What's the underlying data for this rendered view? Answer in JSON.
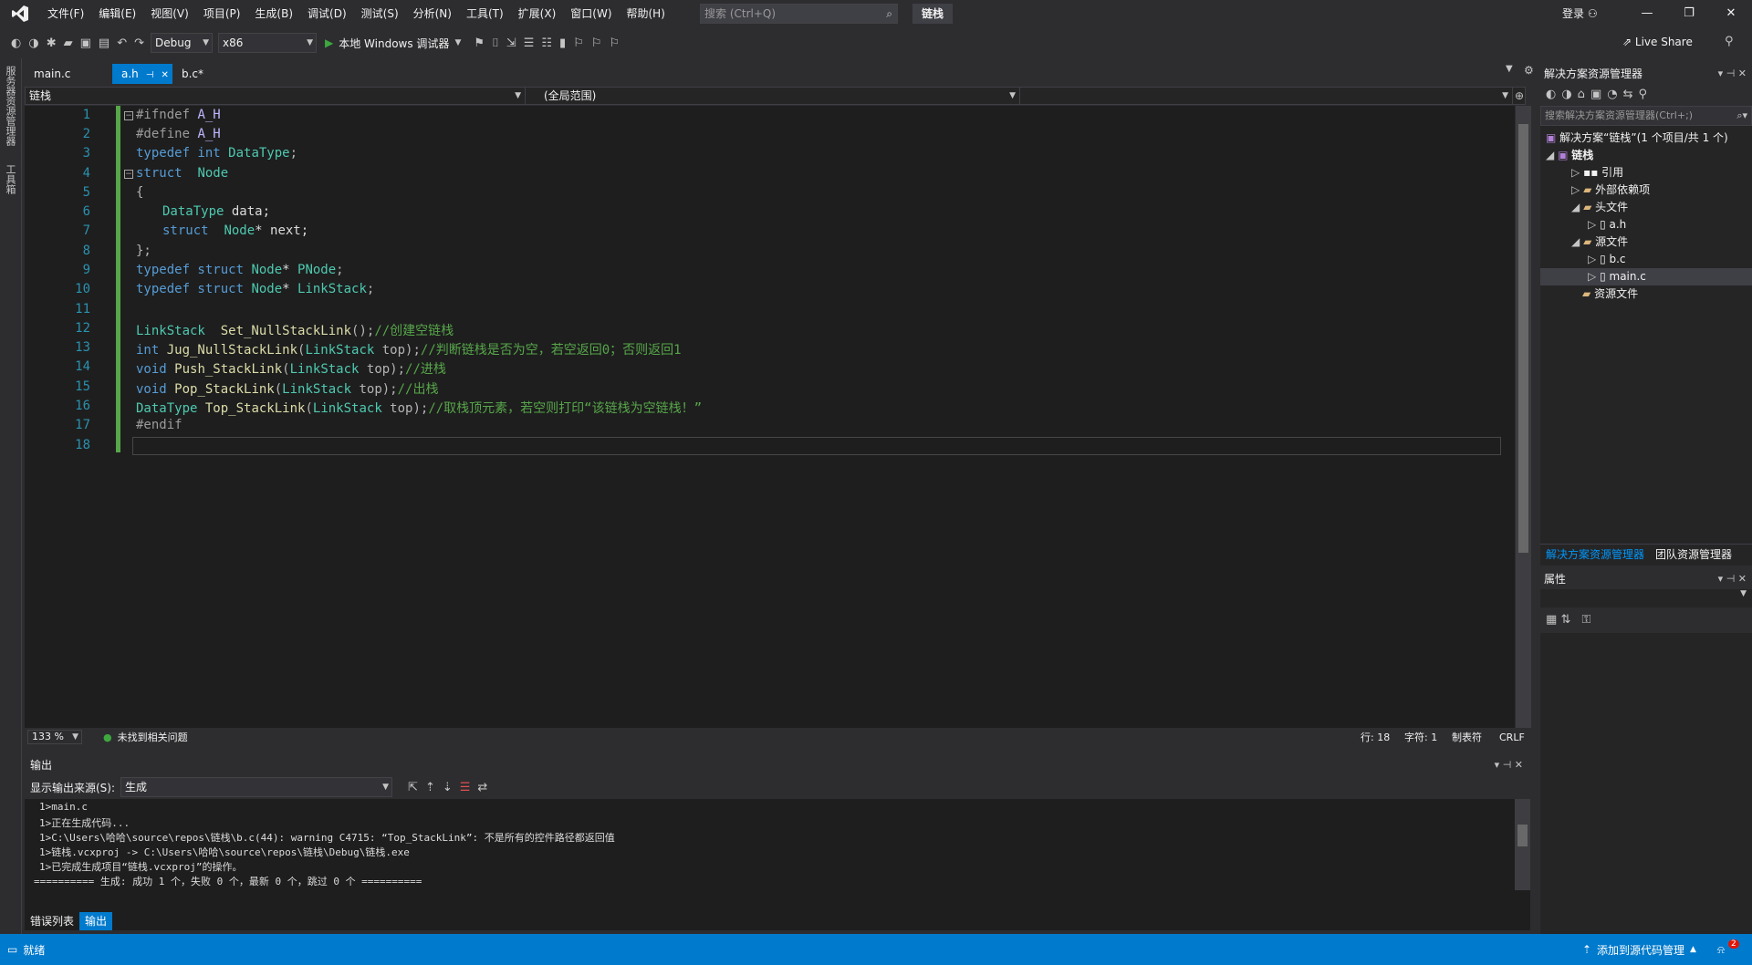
{
  "menu": [
    "文件(F)",
    "编辑(E)",
    "视图(V)",
    "项目(P)",
    "生成(B)",
    "调试(D)",
    "测试(S)",
    "分析(N)",
    "工具(T)",
    "扩展(X)",
    "窗口(W)",
    "帮助(H)"
  ],
  "search_placeholder": "搜索 (Ctrl+Q)",
  "project_title": "链栈",
  "login_label": "登录",
  "toolbar": {
    "config": "Debug",
    "platform": "x86",
    "run_label": "本地 Windows 调试器",
    "live_share": "Live Share"
  },
  "left_tabs": [
    "服务器资源管理器",
    "工具箱"
  ],
  "doc_tabs": [
    {
      "label": "main.c",
      "active": false
    },
    {
      "label": "a.h",
      "active": true
    },
    {
      "label": "b.c*",
      "active": false
    }
  ],
  "nav": {
    "project": "链栈",
    "scope": "(全局范围)",
    "member": ""
  },
  "line_numbers": [
    "1",
    "2",
    "3",
    "4",
    "5",
    "6",
    "7",
    "8",
    "9",
    "10",
    "11",
    "12",
    "13",
    "14",
    "15",
    "16",
    "17",
    "18"
  ],
  "code": {
    "l1a": "#ifndef ",
    "l1b": "A_H",
    "l2a": "#define ",
    "l2b": "A_H",
    "l3a": "typedef int ",
    "l3b": "DataType",
    "l3c": ";",
    "l4a": "struct  ",
    "l4b": "Node",
    "l5": "{",
    "l6a": "DataType",
    "l6b": " data;",
    "l7a": "struct  ",
    "l7b": "Node",
    "l7c": "* next;",
    "l8": "};",
    "l9a": "typedef struct ",
    "l9b": "Node",
    "l9c": "* ",
    "l9d": "PNode",
    "l9e": ";",
    "l10a": "typedef struct ",
    "l10b": "Node",
    "l10c": "* ",
    "l10d": "LinkStack",
    "l10e": ";",
    "l12a": "LinkStack",
    "l12b": "  Set_NullStackLink",
    "l12c": "();",
    "l12d": "//创建空链栈",
    "l13a": "int ",
    "l13b": "Jug_NullStackLink",
    "l13c": "(",
    "l13d": "LinkStack",
    "l13e": " top);",
    "l13f": "//判断链栈是否为空，若空返回0；否则返回1",
    "l14a": "void ",
    "l14b": "Push_StackLink",
    "l14c": "(",
    "l14d": "LinkStack",
    "l14e": " top);",
    "l14f": "//进栈",
    "l15a": "void ",
    "l15b": "Pop_StackLink",
    "l15c": "(",
    "l15d": "LinkStack",
    "l15e": " top);",
    "l15f": "//出栈",
    "l16a": "DataType",
    "l16b": " Top_StackLink",
    "l16c": "(",
    "l16d": "LinkStack",
    "l16e": " top);",
    "l16f": "//取栈顶元素，若空则打印“该链栈为空链栈！”",
    "l17": "#endif"
  },
  "editor_status": {
    "zoom": "133 %",
    "issues": "未找到相关问题",
    "row": "行: 18",
    "col": "字符: 1",
    "tabs": "制表符",
    "eol": "CRLF"
  },
  "solution": {
    "title": "解决方案资源管理器",
    "search_placeholder": "搜索解决方案资源管理器(Ctrl+;)",
    "items": [
      "解决方案“链栈”(1 个项目/共 1 个)",
      "链栈",
      "引用",
      "外部依赖项",
      "头文件",
      "a.h",
      "源文件",
      "b.c",
      "main.c",
      "资源文件"
    ],
    "tab_solution": "解决方案资源管理器",
    "tab_team": "团队资源管理器"
  },
  "properties": {
    "title": "属性"
  },
  "output": {
    "title": "输出",
    "source_label": "显示输出来源(S):",
    "source_value": "生成",
    "lines": [
      "1>main.c",
      "1>正在生成代码...",
      "1>C:\\Users\\哈哈\\source\\repos\\链栈\\b.c(44): warning C4715: “Top_StackLink”: 不是所有的控件路径都返回值",
      "1>链栈.vcxproj -> C:\\Users\\哈哈\\source\\repos\\链栈\\Debug\\链栈.exe",
      "1>已完成生成项目“链栈.vcxproj”的操作。",
      "========== 生成: 成功 1 个，失败 0 个，最新 0 个，跳过 0 个 =========="
    ]
  },
  "bottom_tabs": [
    {
      "label": "错误列表",
      "active": false
    },
    {
      "label": "输出",
      "active": true
    }
  ],
  "statusbar": {
    "ready": "就绪",
    "source_control": "添加到源代码管理",
    "notifications": "2"
  }
}
